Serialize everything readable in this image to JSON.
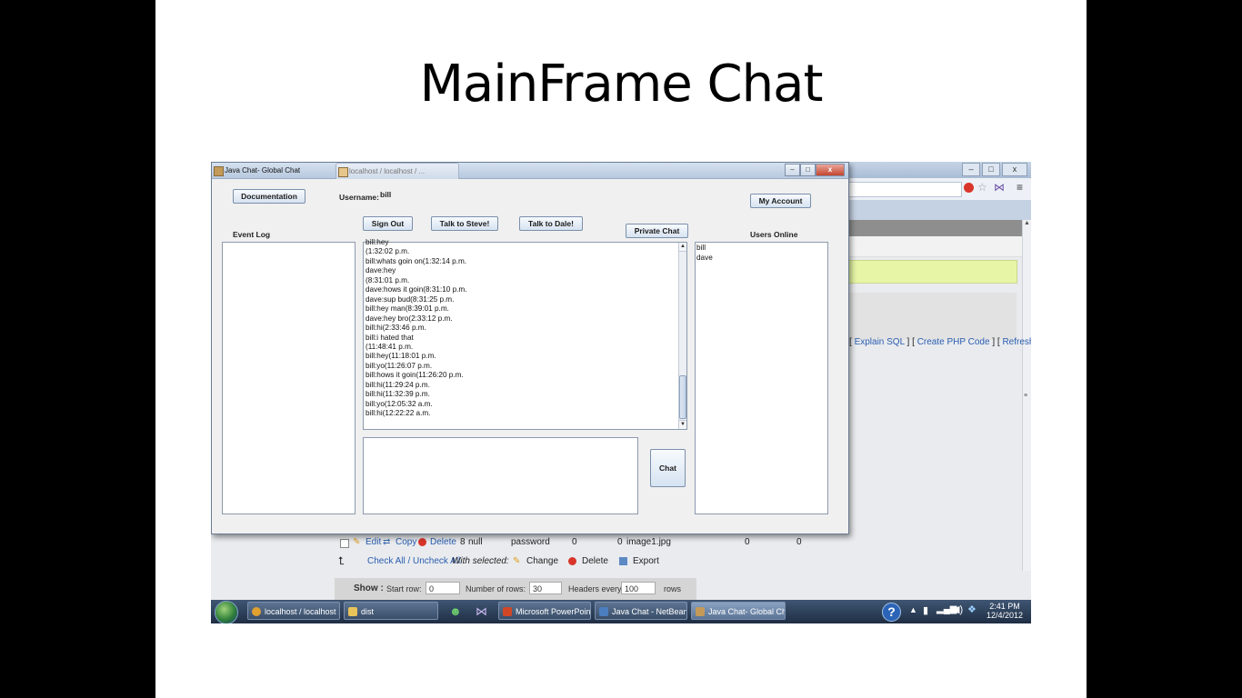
{
  "slide": {
    "title": "MainFrame Chat"
  },
  "background_browser": {
    "links": [
      "Explain SQL",
      "Create PHP Code",
      "Refresh"
    ],
    "row": {
      "edit": "Edit",
      "copy": "Copy",
      "delete": "Delete",
      "id": "8",
      "col_null": "null",
      "col_password": "password",
      "col_zero1": "0",
      "col_zero2": "0",
      "col_image": "image1.jpg",
      "col_zero3": "0",
      "col_zero4": "0"
    },
    "check_all": "Check All / Uncheck All",
    "with_selected": "With selected:",
    "change": "Change",
    "delete": "Delete",
    "export": "Export",
    "show_bar": {
      "show": "Show :",
      "start_row_label": "Start row:",
      "start_row_value": "0",
      "num_rows_label": "Number of rows:",
      "num_rows_value": "30",
      "headers_label": "Headers every",
      "headers_value": "100",
      "rows": "rows"
    }
  },
  "java_window": {
    "title": "Java Chat- Global Chat",
    "second_tab": "localhost / localhost / ...",
    "win_buttons": {
      "minimize": "–",
      "maximize": "□",
      "close": "x"
    },
    "buttons": {
      "documentation": "Documentation",
      "my_account": "My Account",
      "sign_out": "Sign Out",
      "talk_steve": "Talk to Steve!",
      "talk_dale": "Talk to Dale!",
      "private_chat": "Private Chat",
      "chat": "Chat"
    },
    "username_label": "Username:",
    "username_value": "bill",
    "event_log_label": "Event Log",
    "users_online_label": "Users Online",
    "users_online": [
      "bill",
      "dave"
    ],
    "chat_log": [
      "bill:hey",
      "(1:32:02 p.m.",
      "bill:whats goin on(1:32:14 p.m.",
      "dave:hey",
      "(8:31:01 p.m.",
      "dave:hows it goin(8:31:10 p.m.",
      "dave:sup bud(8:31:25 p.m.",
      "bill:hey man(8:39:01 p.m.",
      "dave:hey bro(2:33:12 p.m.",
      "bill:hi(2:33:46 p.m.",
      "bill:i hated that",
      "(11:48:41 p.m.",
      "bill:hey(11:18:01 p.m.",
      "bill:yo(11:26:07 p.m.",
      "bill:hows it goin(11:26:20 p.m.",
      "bill:hi(11:29:24 p.m.",
      "bill:hi(11:32:39 p.m.",
      "bill:yo(12:05:32 a.m.",
      "bill:hi(12:22:22 a.m."
    ],
    "scroll_up": "▲",
    "scroll_down": "▼"
  },
  "taskbar": {
    "items": [
      {
        "label": "localhost / localhost ...",
        "icon": "chrome-icon",
        "color": "#e0a030"
      },
      {
        "label": "dist",
        "icon": "folder-icon",
        "color": "#e8c35a"
      },
      {
        "label": "Microsoft PowerPoin...",
        "icon": "powerpoint-icon",
        "color": "#d24726"
      },
      {
        "label": "Java Chat - NetBeans...",
        "icon": "netbeans-icon",
        "color": "#4a7ebf"
      },
      {
        "label": "Java Chat- Global Chat",
        "icon": "java-icon",
        "color": "#c49a59"
      }
    ],
    "time": "2:41 PM",
    "date": "12/4/2012"
  }
}
